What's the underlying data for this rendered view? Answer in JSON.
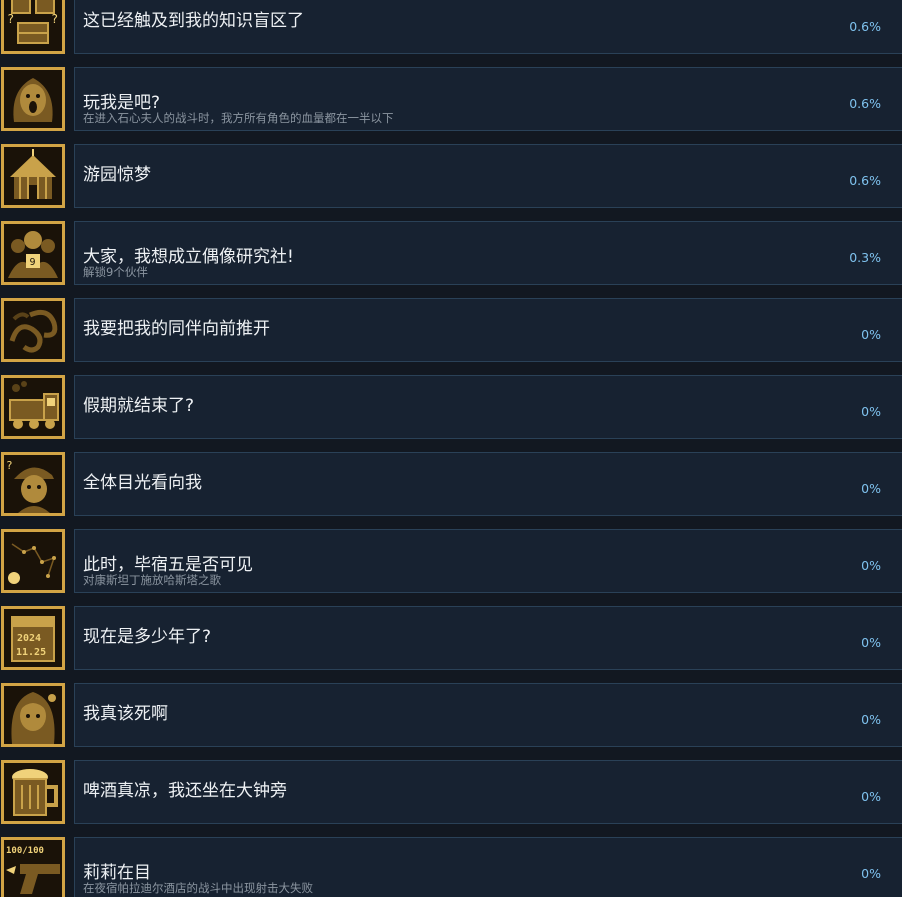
{
  "achievements": [
    {
      "icon": "crates-question-icon",
      "title": "这已经触及到我的知识盲区了",
      "desc": "",
      "pct": "0.6%"
    },
    {
      "icon": "screaming-girl-icon",
      "title": "玩我是吧?",
      "desc": "在进入石心夫人的战斗时，我方所有角色的血量都在一半以下",
      "pct": "0.6%"
    },
    {
      "icon": "circus-tent-icon",
      "title": "游园惊梦",
      "desc": "",
      "pct": "0.6%"
    },
    {
      "icon": "idol-group-icon",
      "title": "大家，我想成立偶像研究社!",
      "desc": "解锁9个伙伴",
      "pct": "0.3%"
    },
    {
      "icon": "swirling-smoke-icon",
      "title": "我要把我的同伴向前推开",
      "desc": "",
      "pct": "0%"
    },
    {
      "icon": "train-icon",
      "title": "假期就结束了?",
      "desc": "",
      "pct": "0%"
    },
    {
      "icon": "cap-boy-question-icon",
      "title": "全体目光看向我",
      "desc": "",
      "pct": "0%"
    },
    {
      "icon": "constellation-icon",
      "title": "此时，毕宿五是否可见",
      "desc": "对康斯坦丁施放哈斯塔之歌",
      "pct": "0%"
    },
    {
      "icon": "calendar-icon",
      "title": "现在是多少年了?",
      "desc": "",
      "pct": "0%"
    },
    {
      "icon": "girl-portrait-icon",
      "title": "我真该死啊",
      "desc": "",
      "pct": "0%"
    },
    {
      "icon": "beer-mug-icon",
      "title": "啤酒真凉，我还坐在大钟旁",
      "desc": "",
      "pct": "0%"
    },
    {
      "icon": "revolver-icon",
      "title": "莉莉在目",
      "desc": "在夜宿帕拉迪尔酒店的战斗中出现射击大失败",
      "pct": "0%"
    }
  ],
  "icon_text": {
    "calendar_year": "2024",
    "calendar_date": "11.25",
    "revolver_counter": "100/100"
  }
}
